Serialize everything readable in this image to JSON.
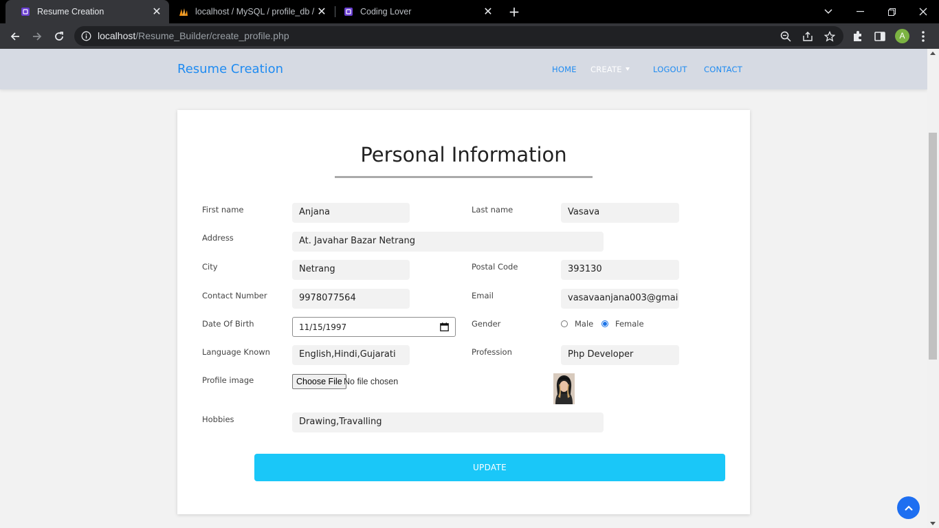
{
  "browser": {
    "tabs": [
      {
        "title": "Resume Creation",
        "active": true
      },
      {
        "title": "localhost / MySQL / profile_db / t",
        "active": false
      },
      {
        "title": "Coding Lover",
        "active": false
      }
    ],
    "url_host": "localhost",
    "url_path": "/Resume_Builder/create_profile.php",
    "profile_initial": "A"
  },
  "site": {
    "brand": "Resume Creation",
    "nav": {
      "home": "HOME",
      "create": "CREATE",
      "logout": "LOGOUT",
      "contact": "CONTACT"
    }
  },
  "form": {
    "heading": "Personal Information",
    "first_name": {
      "label": "First name",
      "value": "Anjana"
    },
    "last_name": {
      "label": "Last name",
      "value": "Vasava"
    },
    "address": {
      "label": "Address",
      "value": "At. Javahar Bazar Netrang"
    },
    "city": {
      "label": "City",
      "value": "Netrang"
    },
    "postal_code": {
      "label": "Postal Code",
      "value": "393130"
    },
    "contact": {
      "label": "Contact Number",
      "value": "9978077564"
    },
    "email": {
      "label": "Email",
      "value": "vasavaanjana003@gmai"
    },
    "dob": {
      "label": "Date Of Birth",
      "value": "11/15/1997"
    },
    "gender": {
      "label": "Gender",
      "options": [
        "Male",
        "Female"
      ],
      "selected": "Female"
    },
    "languages": {
      "label": "Language Known",
      "value": "English,Hindi,Gujarati"
    },
    "profession": {
      "label": "Profession",
      "value": "Php Developer"
    },
    "profile_image": {
      "label": "Profile image",
      "button": "Choose File",
      "status": "No file chosen"
    },
    "hobbies": {
      "label": "Hobbies",
      "value": "Drawing,Travalling"
    },
    "submit": "UPDATE"
  },
  "colors": {
    "accent": "#1f8bf1",
    "button": "#1ac7f8",
    "nav_bg": "#d6dae3"
  }
}
